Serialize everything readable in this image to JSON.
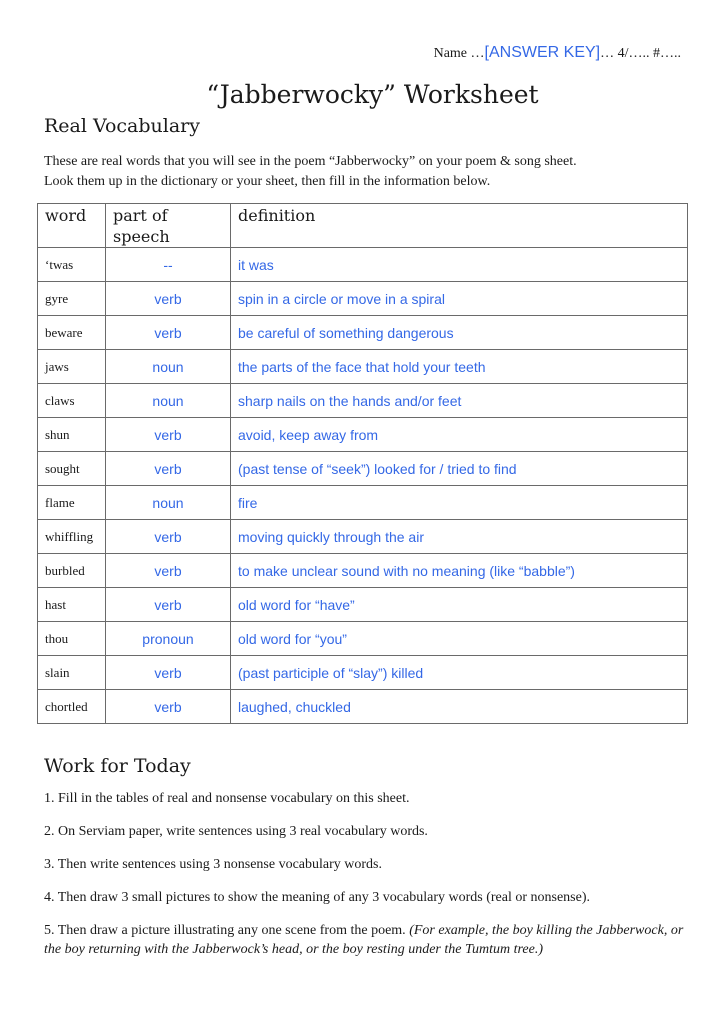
{
  "header": {
    "name_prefix": "Name …",
    "name_value": "[ANSWER KEY]",
    "name_suffix": "…  4/…..  #….."
  },
  "title": "“Jabberwocky” Worksheet",
  "real_vocabulary": {
    "heading": "Real Vocabulary",
    "intro_line1": "These are real words that you will see in the poem “Jabberwocky” on your poem & song sheet.",
    "intro_line2": "Look them up in the dictionary or your sheet, then fill in the information below.",
    "columns": [
      "word",
      "part of speech",
      "definition"
    ],
    "rows": [
      {
        "word": "‘twas",
        "pos": "--",
        "definition": "it was"
      },
      {
        "word": "gyre",
        "pos": "verb",
        "definition": "spin in a circle or move in a spiral"
      },
      {
        "word": "beware",
        "pos": "verb",
        "definition": "be careful of something dangerous"
      },
      {
        "word": "jaws",
        "pos": "noun",
        "definition": "the parts of the face that hold your teeth"
      },
      {
        "word": "claws",
        "pos": "noun",
        "definition": "sharp nails on the hands and/or feet"
      },
      {
        "word": "shun",
        "pos": "verb",
        "definition": "avoid, keep away from"
      },
      {
        "word": "sought",
        "pos": "verb",
        "definition": "(past tense of “seek”) looked for / tried to find"
      },
      {
        "word": "flame",
        "pos": "noun",
        "definition": "fire"
      },
      {
        "word": "whiffling",
        "pos": "verb",
        "definition": "moving quickly through the air"
      },
      {
        "word": "burbled",
        "pos": "verb",
        "definition": "to make unclear sound with no meaning (like “babble”)"
      },
      {
        "word": "hast",
        "pos": "verb",
        "definition": "old word for “have”"
      },
      {
        "word": "thou",
        "pos": "pronoun",
        "definition": "old word for “you”"
      },
      {
        "word": "slain",
        "pos": "verb",
        "definition": "(past participle of “slay”) killed"
      },
      {
        "word": "chortled",
        "pos": "verb",
        "definition": "laughed, chuckled"
      }
    ]
  },
  "work_for_today": {
    "heading": "Work for Today",
    "tasks": [
      "1. Fill in the tables of real and nonsense vocabulary on this sheet.",
      "2. On Serviam paper, write sentences using 3 real vocabulary words.",
      "3. Then write sentences using 3 nonsense vocabulary words.",
      "4. Then draw 3 small pictures to show the meaning of any 3 vocabulary words (real or nonsense)."
    ],
    "task5_main": "5. Then draw a picture illustrating any one scene from the poem. ",
    "task5_italic": "(For example, the boy killing the Jabberwock, or the boy returning with the Jabberwock’s head, or the boy resting under the Tumtum tree.)"
  },
  "colors": {
    "answer_blue": "#3468e6",
    "text": "#1a1a1a",
    "table_border": "#6a6a6a"
  }
}
